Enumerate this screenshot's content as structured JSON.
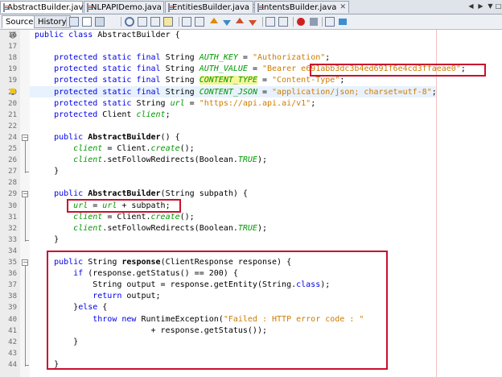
{
  "editor_tabs": [
    {
      "label": "AbstractBuilder.java",
      "active": true
    },
    {
      "label": "NLPAPIDemo.java",
      "active": false
    },
    {
      "label": "EntitiesBuilder.java",
      "active": false
    },
    {
      "label": "IntentsBuilder.java",
      "active": false
    }
  ],
  "toolbar": {
    "source_label": "Source",
    "history_label": "History"
  },
  "gutter_icons": {
    "line_0": "@",
    "line_20": "warning-bulb"
  },
  "lines": [
    {
      "n": "16",
      "tokens": [
        {
          "t": "public class ",
          "c": "kw"
        },
        {
          "t": "AbstractBuilder {",
          "c": "cls"
        }
      ]
    },
    {
      "n": "17",
      "tokens": []
    },
    {
      "n": "18",
      "tokens": [
        {
          "t": "    protected static final ",
          "c": "kw"
        },
        {
          "t": "String ",
          "c": "cls"
        },
        {
          "t": "AUTH_KEY",
          "c": "fld"
        },
        {
          "t": " = ",
          "c": "cls"
        },
        {
          "t": "\"Authorization\"",
          "c": "str"
        },
        {
          "t": ";",
          "c": "cls"
        }
      ]
    },
    {
      "n": "19",
      "tokens": [
        {
          "t": "    protected static final ",
          "c": "kw"
        },
        {
          "t": "String ",
          "c": "cls"
        },
        {
          "t": "AUTH_VALUE",
          "c": "fld"
        },
        {
          "t": " = ",
          "c": "cls"
        },
        {
          "t": "\"Bearer ",
          "c": "str"
        },
        {
          "t": "e691abb3dc3b4ed691f6e4cd3ffaeae0\"",
          "c": "str"
        },
        {
          "t": ";",
          "c": "cls"
        }
      ]
    },
    {
      "n": "19",
      "tokens": [
        {
          "t": "    protected static final ",
          "c": "kw"
        },
        {
          "t": "String ",
          "c": "cls"
        },
        {
          "t": "CONTENT_TYPE",
          "c": "fld hl"
        },
        {
          "t": " = ",
          "c": "cls"
        },
        {
          "t": "\"Content-Type\"",
          "c": "str"
        },
        {
          "t": ";",
          "c": "cls"
        }
      ]
    },
    {
      "n": "20",
      "tokens": [
        {
          "t": "    protected static final ",
          "c": "kw"
        },
        {
          "t": "String ",
          "c": "cls"
        },
        {
          "t": "CONTENT_JSON",
          "c": "fld"
        },
        {
          "t": " = ",
          "c": "cls"
        },
        {
          "t": "\"application/json; charset=utf-8\"",
          "c": "str"
        },
        {
          "t": ";",
          "c": "cls"
        }
      ]
    },
    {
      "n": "20",
      "tokens": [
        {
          "t": "    protected static ",
          "c": "kw"
        },
        {
          "t": "String ",
          "c": "cls"
        },
        {
          "t": "url",
          "c": "fld"
        },
        {
          "t": " = ",
          "c": "cls"
        },
        {
          "t": "\"https://api.api.ai/v1\"",
          "c": "str"
        },
        {
          "t": ";",
          "c": "cls"
        }
      ]
    },
    {
      "n": "21",
      "tokens": [
        {
          "t": "    protected ",
          "c": "kw"
        },
        {
          "t": "Client ",
          "c": "cls"
        },
        {
          "t": "client",
          "c": "fld"
        },
        {
          "t": ";",
          "c": "cls"
        }
      ]
    },
    {
      "n": "22",
      "tokens": []
    },
    {
      "n": "24",
      "tokens": [
        {
          "t": "    public ",
          "c": "kw"
        },
        {
          "t": "AbstractBuilder",
          "c": "bld"
        },
        {
          "t": "() {",
          "c": "cls"
        }
      ]
    },
    {
      "n": "25",
      "tokens": [
        {
          "t": "        ",
          "c": "cls"
        },
        {
          "t": "client",
          "c": "fld"
        },
        {
          "t": " = Client.",
          "c": "cls"
        },
        {
          "t": "create",
          "c": "fld"
        },
        {
          "t": "();",
          "c": "cls"
        }
      ]
    },
    {
      "n": "26",
      "tokens": [
        {
          "t": "        ",
          "c": "cls"
        },
        {
          "t": "client",
          "c": "fld"
        },
        {
          "t": ".setFollowRedirects(Boolean.",
          "c": "cls"
        },
        {
          "t": "TRUE",
          "c": "fld"
        },
        {
          "t": ");",
          "c": "cls"
        }
      ]
    },
    {
      "n": "27",
      "tokens": [
        {
          "t": "    }",
          "c": "cls"
        }
      ]
    },
    {
      "n": "28",
      "tokens": []
    },
    {
      "n": "29",
      "tokens": [
        {
          "t": "    public ",
          "c": "kw"
        },
        {
          "t": "AbstractBuilder",
          "c": "bld"
        },
        {
          "t": "(String subpath) {",
          "c": "cls"
        }
      ]
    },
    {
      "n": "30",
      "tokens": [
        {
          "t": "        ",
          "c": "cls"
        },
        {
          "t": "url",
          "c": "fld"
        },
        {
          "t": " = ",
          "c": "cls"
        },
        {
          "t": "url",
          "c": "fld"
        },
        {
          "t": " + subpath;",
          "c": "cls"
        }
      ]
    },
    {
      "n": "31",
      "tokens": [
        {
          "t": "        ",
          "c": "cls"
        },
        {
          "t": "client",
          "c": "fld"
        },
        {
          "t": " = Client.",
          "c": "cls"
        },
        {
          "t": "create",
          "c": "fld"
        },
        {
          "t": "();",
          "c": "cls"
        }
      ]
    },
    {
      "n": "32",
      "tokens": [
        {
          "t": "        ",
          "c": "cls"
        },
        {
          "t": "client",
          "c": "fld"
        },
        {
          "t": ".setFollowRedirects(Boolean.",
          "c": "cls"
        },
        {
          "t": "TRUE",
          "c": "fld"
        },
        {
          "t": ");",
          "c": "cls"
        }
      ]
    },
    {
      "n": "33",
      "tokens": [
        {
          "t": "    }",
          "c": "cls"
        }
      ]
    },
    {
      "n": "34",
      "tokens": []
    },
    {
      "n": "35",
      "tokens": [
        {
          "t": "    public ",
          "c": "kw"
        },
        {
          "t": "String ",
          "c": "cls"
        },
        {
          "t": "response",
          "c": "bld"
        },
        {
          "t": "(ClientResponse response) {",
          "c": "cls"
        }
      ]
    },
    {
      "n": "36",
      "tokens": [
        {
          "t": "        if ",
          "c": "kw"
        },
        {
          "t": "(response.getStatus() == 200) {",
          "c": "cls"
        }
      ]
    },
    {
      "n": "37",
      "tokens": [
        {
          "t": "            String output = response.getEntity(String.",
          "c": "cls"
        },
        {
          "t": "class",
          "c": "kw"
        },
        {
          "t": ");",
          "c": "cls"
        }
      ]
    },
    {
      "n": "38",
      "tokens": [
        {
          "t": "            return ",
          "c": "kw"
        },
        {
          "t": "output;",
          "c": "cls"
        }
      ]
    },
    {
      "n": "39",
      "tokens": [
        {
          "t": "        }",
          "c": "cls"
        },
        {
          "t": "else ",
          "c": "kw"
        },
        {
          "t": "{",
          "c": "cls"
        }
      ]
    },
    {
      "n": "40",
      "tokens": [
        {
          "t": "            throw new ",
          "c": "kw"
        },
        {
          "t": "RuntimeException(",
          "c": "cls"
        },
        {
          "t": "\"Failed : HTTP error code : \"",
          "c": "str"
        }
      ]
    },
    {
      "n": "41",
      "tokens": [
        {
          "t": "                        + response.getStatus());",
          "c": "cls"
        }
      ]
    },
    {
      "n": "42",
      "tokens": [
        {
          "t": "        }",
          "c": "cls"
        }
      ]
    },
    {
      "n": "43",
      "tokens": []
    },
    {
      "n": "44",
      "tokens": [
        {
          "t": "    }",
          "c": "cls"
        }
      ]
    }
  ],
  "colors": {
    "keyword": "#0000e6",
    "field": "#009900",
    "string": "#ce7b00",
    "highlight_box": "#c8102e"
  }
}
